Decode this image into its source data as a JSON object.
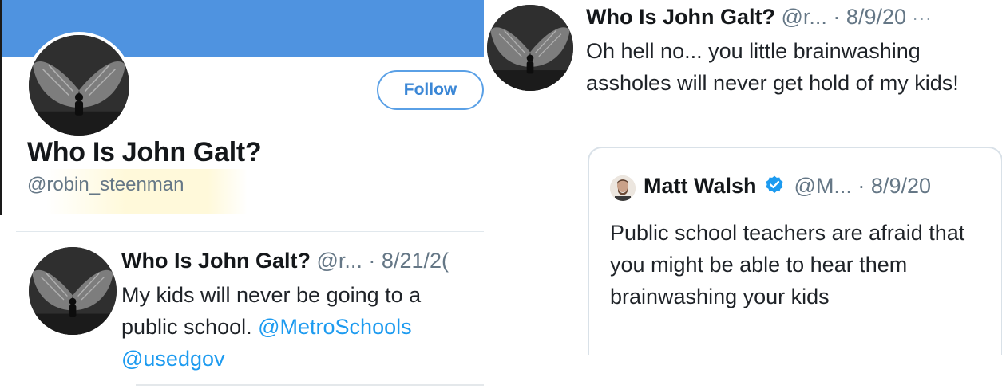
{
  "profile": {
    "follow_label": "Follow",
    "name": "Who Is John Galt?",
    "handle": "@robin_steenman",
    "banner_color": "#4f93e0"
  },
  "tweet1": {
    "name": "Who Is John Galt?",
    "meta": "@r... · 8/21/2(",
    "text": "My kids will never be going to a public school.",
    "mentions": [
      "@MetroSchools",
      "@usedgov"
    ]
  },
  "tweet2": {
    "name": "Who Is John Galt?",
    "meta": "@r...  · 8/9/20",
    "more": "···",
    "text": "Oh hell no... you little brainwashing assholes will never get hold of my kids!",
    "quote": {
      "name": "Matt Walsh",
      "meta": "@M... · 8/9/20",
      "text": "Public school teachers are afraid that you might be able to hear them brainwashing your kids",
      "verified_color": "#1d9bf0"
    }
  },
  "colors": {
    "link": "#1d9bf0",
    "secondary_text": "#657786"
  }
}
